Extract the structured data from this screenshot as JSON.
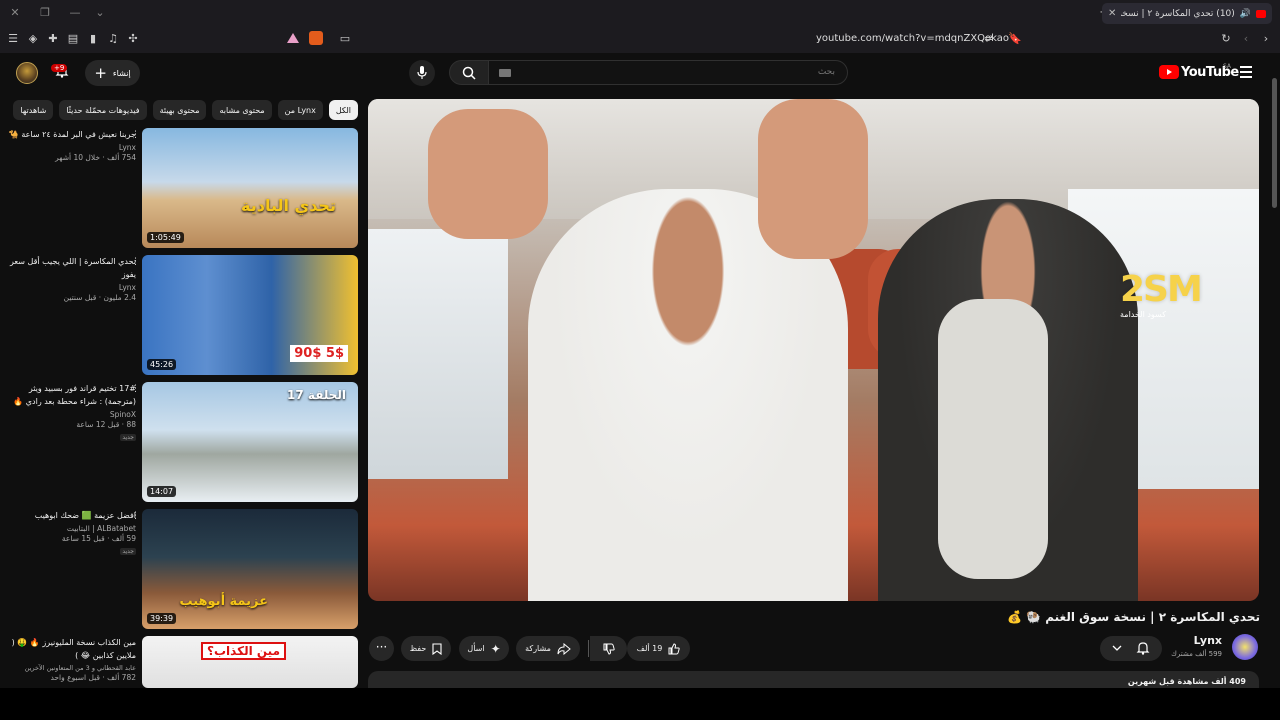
{
  "browser": {
    "tab_title": "(10) تحدي المكاسرة ٢ | نسخة س...",
    "url": "youtube.com/watch?v=mdqnZXQokao"
  },
  "yt": {
    "brand": "YouTube",
    "region": "SA",
    "search_placeholder": "بحث",
    "create_label": "إنشاء",
    "notif_count": "+9"
  },
  "chips": [
    {
      "label": "الكل",
      "active": true
    },
    {
      "label": "من Lynx"
    },
    {
      "label": "محتوى مشابه"
    },
    {
      "label": "محتوى بهيئة"
    },
    {
      "label": "فيديوهات محمّلة حديثًا"
    },
    {
      "label": "شاهدتها"
    }
  ],
  "recommendations": [
    {
      "title": "جربنا نعيش في البر لمدة ٢٤ ساعة 🐪",
      "channel": "Lynx",
      "meta": "754 ألف · خلال 10 أشهر",
      "duration": "1:05:49",
      "thumb_text": "تحدي البادية"
    },
    {
      "title": "تحدي المكاسرة | اللي يجيب أقل سعر يفوز",
      "channel": "Lynx",
      "meta": "2.4 مليون · قبل سنتين",
      "duration": "45:26",
      "thumb_text": "90$ 5$"
    },
    {
      "title": "17# تختيم قراند فور بسبيد ويثر (مترجمة) : شراء محطة بعد رادي 🔥",
      "channel": "SpinoX",
      "meta": "88 · قبل 12 ساعة",
      "badge": "جديد",
      "duration": "14:07",
      "thumb_text": "الحلقة 17"
    },
    {
      "title": "افضل عزيمة 🟩 ضحك ابوهيب",
      "channel": "ALBatabet | البتابيت",
      "meta": "59 ألف · قبل 15 ساعة",
      "badge": "جديد",
      "duration": "39:39",
      "thumb_text": "عزيمة أبوهيب"
    },
    {
      "title": "مين الكذاب نسخة المليونيرز 🔥 🤑 ( ملايين كذابين 😂 )",
      "channel": "عابد القحطاني و 3 من المتعاونين الآخرين",
      "meta": "782 ألف · قبل اسبوع واحد",
      "duration": "",
      "thumb_text": "مين الكذاب؟"
    }
  ],
  "video": {
    "overlay_logo": "2SM",
    "overlay_sub": "كسود الخدامة",
    "title": "تحدي المكاسرة ٢ | نسخة سوق الغنم 🐏 💰",
    "channel": "Lynx",
    "subscribers": "599 ألف مشترك",
    "likes": "19 ألف",
    "share_label": "مشاركة",
    "ask_label": "اسأل",
    "save_label": "حفظ",
    "stats": "409 ألف مشاهدة قبل شهرين"
  }
}
